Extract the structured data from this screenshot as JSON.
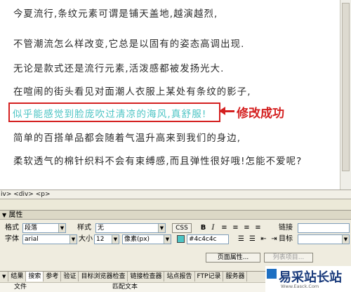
{
  "document": {
    "paragraphs": [
      "今夏流行,条纹元素可谓是铺天盖地,越演越烈,",
      "不管潮流怎么样改变,它总是以固有的姿态高调出现.",
      "无论是款式还是流行元素,活泼感都被发扬光大.",
      "在喧闹的街头看见对面潮人衣服上某处有条纹的影子,",
      "似乎能感觉到脸庞吹过清凉的海风,真舒服!",
      "简单的百搭单品都会随着气温升高来到我们的身边,",
      "柔软透气的棉针织料不会有束缚感,而且弹性很好哦!怎能不爱呢?"
    ],
    "annotation": "修改成功",
    "highlight_color": "#4cc4c4",
    "annotation_color": "#d42020"
  },
  "tag_selector": "iv> <div> <p>",
  "properties": {
    "title": "属性",
    "format_label": "格式",
    "format_value": "段落",
    "style_label": "样式",
    "style_value": "无",
    "css_label": "CSS",
    "bold": "B",
    "italic": "I",
    "link_label": "链接",
    "font_label": "字体",
    "font_value": "arial",
    "size_label": "大小",
    "size_value": "12",
    "unit_value": "像素(px)",
    "color_value": "#4c4c4c",
    "target_label": "目标",
    "page_props_button": "页面属性...",
    "list_items_button": "列表项目..."
  },
  "results": {
    "tabs": [
      "结果",
      "搜索",
      "参考",
      "验证",
      "目标浏览器检查",
      "链接检查器",
      "站点报告",
      "FTP记录",
      "服务器"
    ],
    "active_tab": "搜索",
    "columns": [
      "文件",
      "匹配文本"
    ]
  },
  "watermark": {
    "text": "易采站长站",
    "url": "Www.Easck.Com"
  }
}
